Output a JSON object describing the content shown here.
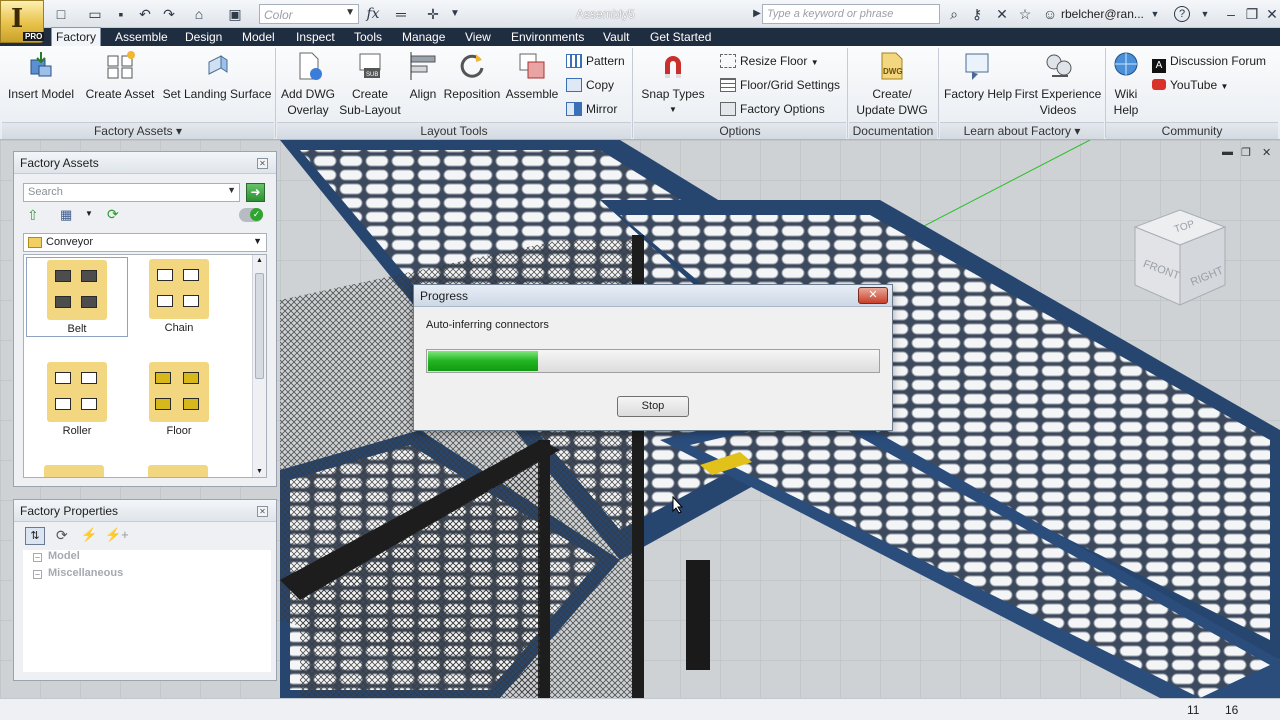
{
  "titlebar": {
    "app_logo": "I",
    "app_edition": "PRO",
    "color_combo": "Color",
    "document_title": "Assembly5",
    "search_placeholder": "Type a keyword or phrase",
    "user_name": "rbelcher@ran...",
    "icons": [
      "new-icon",
      "open-icon",
      "save-icon",
      "undo-icon",
      "redo-icon",
      "return-icon",
      "select-icon",
      "fx-icon",
      "measure-icon",
      "move-icon",
      "binoculars-icon",
      "key-icon",
      "star-icon",
      "user-icon",
      "help-icon"
    ]
  },
  "tabs": [
    "Factory",
    "Assemble",
    "Design",
    "Model",
    "Inspect",
    "Tools",
    "Manage",
    "View",
    "Environments",
    "Vault",
    "Get Started"
  ],
  "active_tab": "Factory",
  "ribbon": {
    "factory_assets": {
      "group_label": "Factory Assets",
      "insert_model": "Insert Model",
      "create_asset": "Create Asset",
      "set_landing_surface": "Set Landing Surface"
    },
    "layout_tools": {
      "group_label": "Layout Tools",
      "add_dwg_overlay": [
        "Add DWG",
        "Overlay"
      ],
      "create_sub_layout": [
        "Create",
        "Sub-Layout"
      ],
      "align": "Align",
      "reposition": "Reposition",
      "assemble": "Assemble",
      "pattern": "Pattern",
      "copy": "Copy",
      "mirror": "Mirror"
    },
    "options": {
      "group_label": "Options",
      "snap_types": "Snap Types",
      "resize_floor": "Resize Floor",
      "floor_grid_settings": "Floor/Grid Settings",
      "factory_options": "Factory Options"
    },
    "documentation": {
      "group_label": "Documentation",
      "create_update_dwg": [
        "Create/",
        "Update DWG"
      ]
    },
    "learn": {
      "group_label": "Learn about Factory",
      "factory_help": "Factory Help",
      "first_experience_videos": [
        "First Experience",
        "Videos"
      ]
    },
    "community": {
      "group_label": "Community",
      "wiki_help": [
        "Wiki",
        "Help"
      ],
      "discussion_forum": "Discussion Forum",
      "youtube": "YouTube"
    }
  },
  "factory_assets_panel": {
    "title": "Factory Assets",
    "search_placeholder": "Search",
    "category": "Conveyor",
    "assets": [
      "Belt",
      "Chain",
      "Roller",
      "Floor"
    ],
    "selected_asset": "Belt"
  },
  "factory_properties_panel": {
    "title": "Factory Properties",
    "rows": [
      "Model",
      "Miscellaneous"
    ]
  },
  "progress_dialog": {
    "title": "Progress",
    "message": "Auto-inferring connectors",
    "progress_fraction": 0.245,
    "stop_label": "Stop"
  },
  "viewcube": {
    "top": "TOP",
    "front": "FRONT",
    "right": "RIGHT"
  },
  "statusbar": {
    "left_value": "11",
    "right_value": "16"
  }
}
